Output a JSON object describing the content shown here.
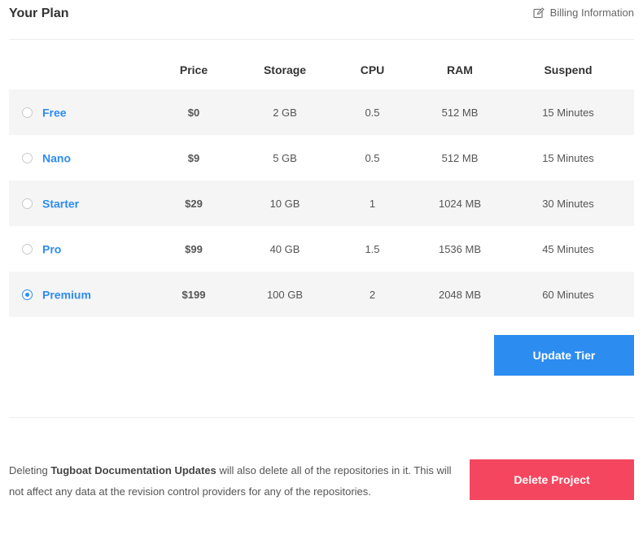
{
  "header": {
    "title": "Your Plan",
    "billing_link": "Billing Information",
    "billing_icon": "edit-icon"
  },
  "table": {
    "columns": [
      "",
      "Price",
      "Storage",
      "CPU",
      "RAM",
      "Suspend"
    ],
    "rows": [
      {
        "name": "Free",
        "price": "$0",
        "storage": "2 GB",
        "cpu": "0.5",
        "ram": "512 MB",
        "suspend": "15 Minutes",
        "selected": false
      },
      {
        "name": "Nano",
        "price": "$9",
        "storage": "5 GB",
        "cpu": "0.5",
        "ram": "512 MB",
        "suspend": "15 Minutes",
        "selected": false
      },
      {
        "name": "Starter",
        "price": "$29",
        "storage": "10 GB",
        "cpu": "1",
        "ram": "1024 MB",
        "suspend": "30 Minutes",
        "selected": false
      },
      {
        "name": "Pro",
        "price": "$99",
        "storage": "40 GB",
        "cpu": "1.5",
        "ram": "1536 MB",
        "suspend": "45 Minutes",
        "selected": false
      },
      {
        "name": "Premium",
        "price": "$199",
        "storage": "100 GB",
        "cpu": "2",
        "ram": "2048 MB",
        "suspend": "60 Minutes",
        "selected": true
      }
    ]
  },
  "update_button": "Update Tier",
  "delete_section": {
    "text_before": "Deleting ",
    "project_name": "Tugboat Documentation Updates",
    "text_after": " will also delete all of the repositories in it. This will not affect any data at the revision control providers for any of the repositories.",
    "button": "Delete Project"
  },
  "colors": {
    "accent": "#2d8cf0",
    "danger": "#f4475f",
    "row_stripe": "#f5f5f5"
  }
}
